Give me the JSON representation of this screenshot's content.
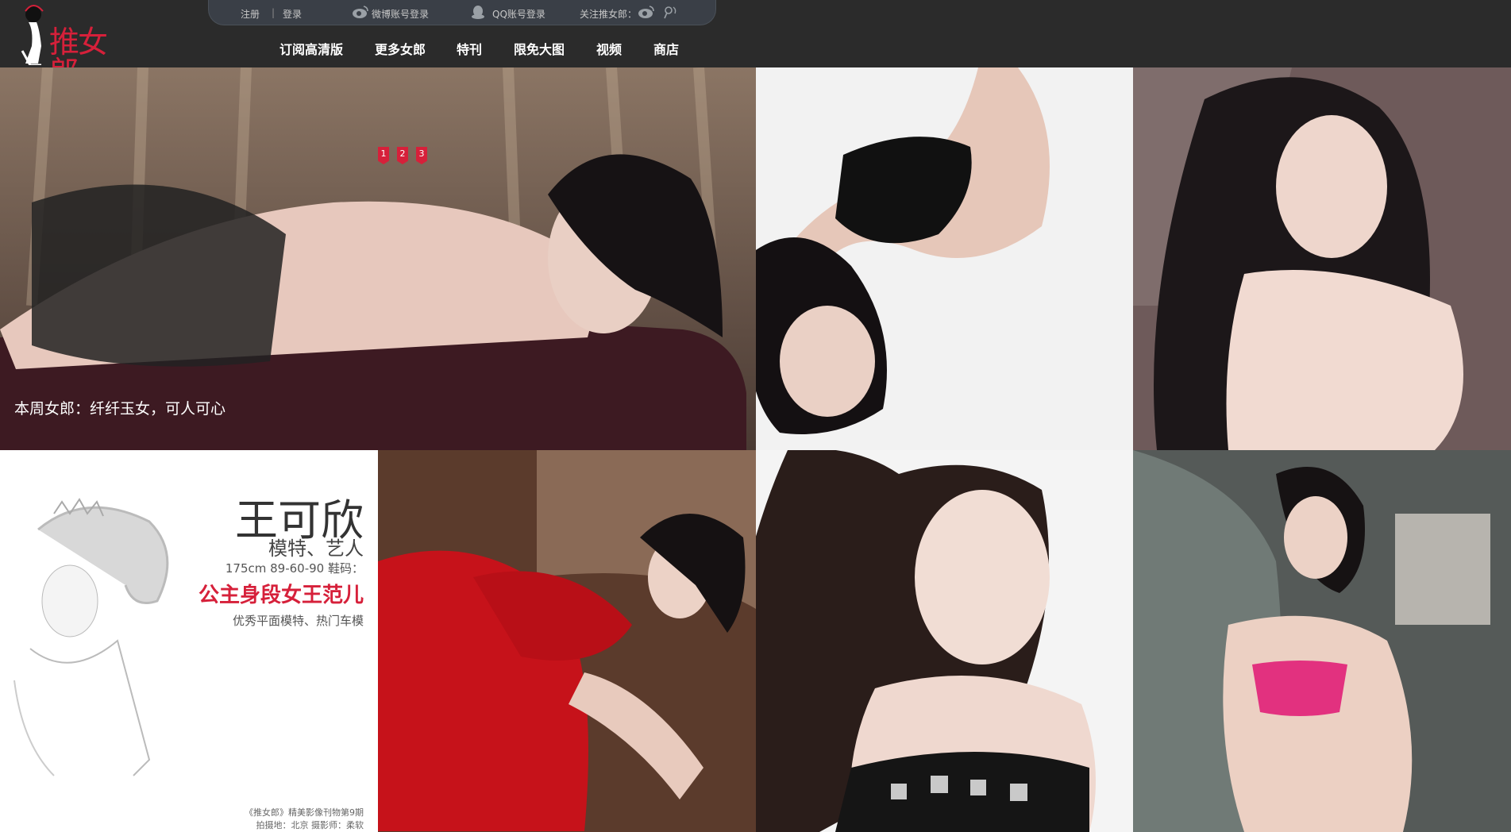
{
  "header": {
    "logo_text": "推女郎",
    "topbar": {
      "register": "注册",
      "separator": "|",
      "login": "登录",
      "weibo_login": "微博账号登录",
      "qq_login": "QQ账号登录",
      "follow": "关注推女郎："
    },
    "nav": [
      {
        "label": "订阅高清版"
      },
      {
        "label": "更多女郎"
      },
      {
        "label": "特刊"
      },
      {
        "label": "限免大图"
      },
      {
        "label": "视频"
      },
      {
        "label": "商店"
      }
    ]
  },
  "slider": {
    "dots": [
      "1",
      "2",
      "3"
    ],
    "caption": "本周女郎：纤纤玉女，可人可心"
  },
  "profile": {
    "name": "王可欣",
    "role": "模特、艺人",
    "stats": "175cm 89-60-90 鞋码：",
    "tagline": "公主身段女王范儿",
    "description": "优秀平面模特、热门车模",
    "credit_line1": "《推女郎》精美影像刊物第9期",
    "credit_line2": "拍摄地：北京 摄影师：柔软"
  },
  "colors": {
    "header_bg": "#2b2b2b",
    "accent": "#d6203a",
    "topbar_bg": "#3a3f47"
  },
  "icons": [
    "weibo-icon",
    "qq-icon",
    "weibo-follow-icon",
    "tencent-weibo-icon"
  ]
}
